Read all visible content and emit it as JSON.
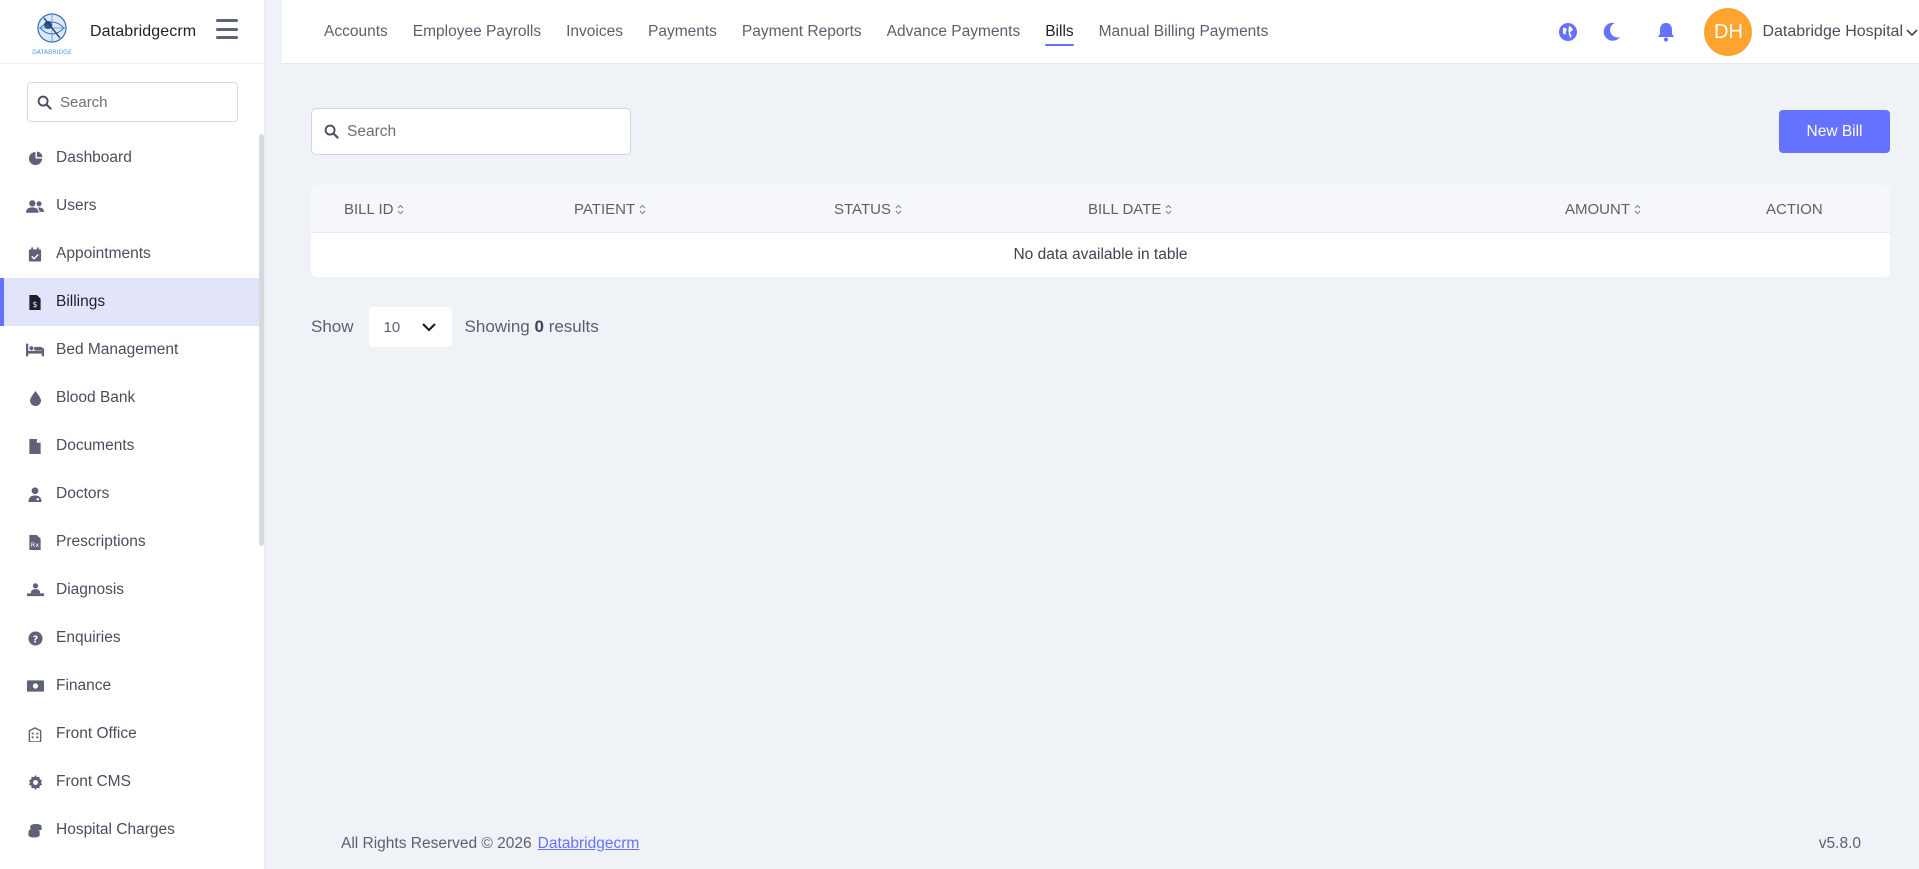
{
  "brand": {
    "logo_text": "DATABRIDGE",
    "name": "Databridgecrm"
  },
  "sidebar": {
    "search_placeholder": "Search",
    "items": [
      {
        "label": "Dashboard",
        "icon": "pie-chart-icon"
      },
      {
        "label": "Users",
        "icon": "users-icon"
      },
      {
        "label": "Appointments",
        "icon": "calendar-check-icon"
      },
      {
        "label": "Billings",
        "icon": "invoice-icon",
        "active": true
      },
      {
        "label": "Bed Management",
        "icon": "bed-icon"
      },
      {
        "label": "Blood Bank",
        "icon": "droplet-icon"
      },
      {
        "label": "Documents",
        "icon": "file-icon"
      },
      {
        "label": "Doctors",
        "icon": "doctor-icon"
      },
      {
        "label": "Prescriptions",
        "icon": "prescription-icon"
      },
      {
        "label": "Diagnosis",
        "icon": "diagnosis-icon"
      },
      {
        "label": "Enquiries",
        "icon": "question-circle-icon"
      },
      {
        "label": "Finance",
        "icon": "money-icon"
      },
      {
        "label": "Front Office",
        "icon": "building-icon"
      },
      {
        "label": "Front CMS",
        "icon": "gear-icon"
      },
      {
        "label": "Hospital Charges",
        "icon": "coins-icon"
      }
    ]
  },
  "topnav": {
    "tabs": [
      {
        "label": "Accounts"
      },
      {
        "label": "Employee Payrolls"
      },
      {
        "label": "Invoices"
      },
      {
        "label": "Payments"
      },
      {
        "label": "Payment Reports"
      },
      {
        "label": "Advance Payments"
      },
      {
        "label": "Bills",
        "active": true
      },
      {
        "label": "Manual Billing Payments"
      }
    ],
    "user": {
      "initials": "DH",
      "name": "Databridge Hospital"
    },
    "icons": [
      "globe-icon",
      "moon-icon",
      "bell-icon"
    ]
  },
  "main": {
    "search_placeholder": "Search",
    "new_button_label": "New Bill",
    "table": {
      "columns": [
        "BILL ID",
        "PATIENT",
        "STATUS",
        "BILL DATE",
        "AMOUNT",
        "ACTION"
      ],
      "empty_message": "No data available in table"
    },
    "pager": {
      "show_label": "Show",
      "per_page": "10",
      "showing_prefix": "Showing",
      "count": "0",
      "showing_suffix": "results"
    }
  },
  "footer": {
    "copyright": "All Rights Reserved © 2026",
    "link": "Databridgecrm",
    "version": "v5.8.0"
  },
  "colors": {
    "accent": "#6571ff",
    "avatar": "#ffa42e",
    "active_bg": "#e1e4fb"
  }
}
